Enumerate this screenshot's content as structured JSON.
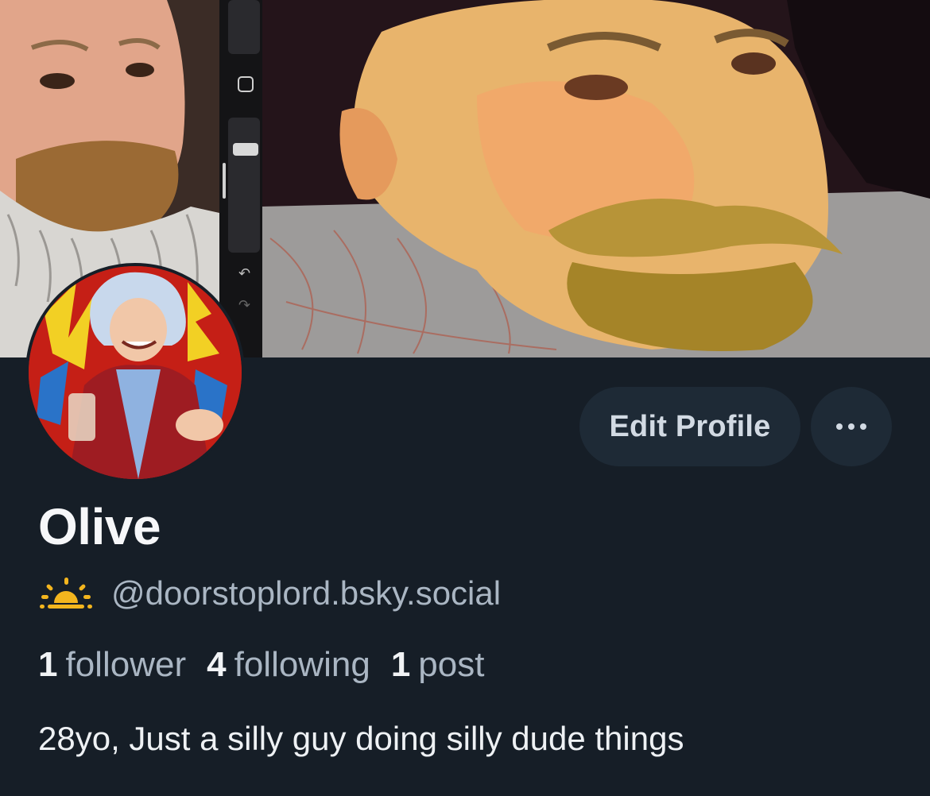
{
  "banner": {
    "label": "profile banner image"
  },
  "avatar": {
    "label": "profile avatar"
  },
  "actions": {
    "edit_profile_label": "Edit Profile",
    "more_icon": "ellipsis-horizontal-icon"
  },
  "profile": {
    "display_name": "Olive",
    "handle_icon": "sunrise-emoji-icon",
    "handle": "@doorstoplord.bsky.social",
    "bio": "28yo, Just a silly guy doing silly dude things"
  },
  "stats": {
    "followers_count": "1",
    "followers_label": "follower",
    "following_count": "4",
    "following_label": "following",
    "posts_count": "1",
    "posts_label": "post"
  },
  "colors": {
    "background": "#161e27",
    "button_bg": "#1e2a36",
    "muted_text": "#aab6c3",
    "sun_icon": "#f3b51e"
  }
}
